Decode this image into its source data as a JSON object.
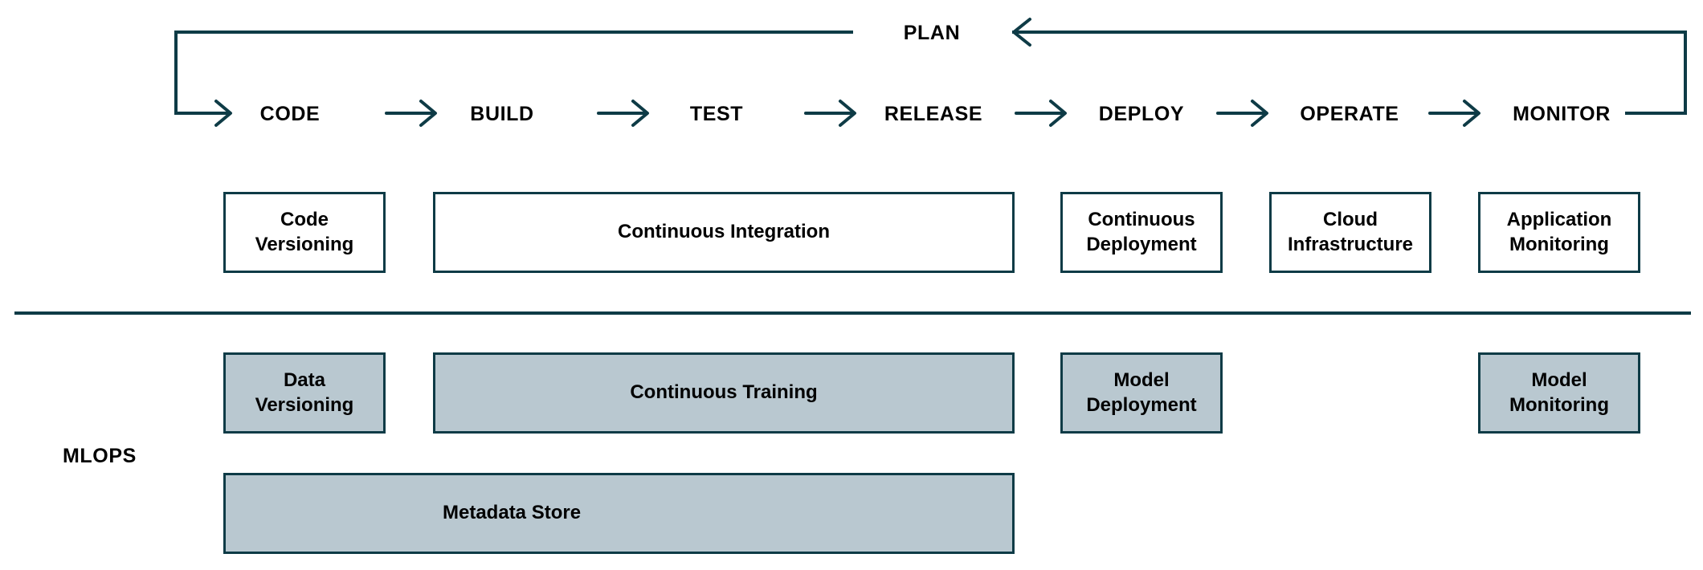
{
  "diagram": {
    "title": "DevOps and MLOps pipeline diagram",
    "colors": {
      "line": "#0e3b46",
      "text": "#000000",
      "devops_box_fill": "#ffffff",
      "mlops_box_fill": "#b9c8d0",
      "background": "#ffffff"
    }
  },
  "pipeline": {
    "plan_label": "PLAN",
    "stages": [
      {
        "label": "CODE"
      },
      {
        "label": "BUILD"
      },
      {
        "label": "TEST"
      },
      {
        "label": "RELEASE"
      },
      {
        "label": "DEPLOY"
      },
      {
        "label": "OPERATE"
      },
      {
        "label": "MONITOR"
      }
    ]
  },
  "devops_row": {
    "boxes": [
      {
        "label": "Code\nVersioning",
        "line1": "Code",
        "line2": "Versioning"
      },
      {
        "label": "Continuous Integration",
        "line1": "Continuous Integration",
        "line2": ""
      },
      {
        "label": "Continuous\nDeployment",
        "line1": "Continuous",
        "line2": "Deployment"
      },
      {
        "label": "Cloud\nInfrastructure",
        "line1": "Cloud",
        "line2": "Infrastructure"
      },
      {
        "label": "Application\nMonitoring",
        "line1": "Application",
        "line2": "Monitoring"
      }
    ]
  },
  "mlops_section": {
    "section_label": "MLOPS",
    "boxes": [
      {
        "label": "Data\nVersioning",
        "line1": "Data",
        "line2": "Versioning"
      },
      {
        "label": "Continuous Training",
        "line1": "Continuous Training",
        "line2": ""
      },
      {
        "label": "Model\nDeployment",
        "line1": "Model",
        "line2": "Deployment"
      },
      {
        "label": "Model\nMonitoring",
        "line1": "Model",
        "line2": "Monitoring"
      }
    ],
    "wide_box": {
      "label": "Metadata Store"
    }
  }
}
